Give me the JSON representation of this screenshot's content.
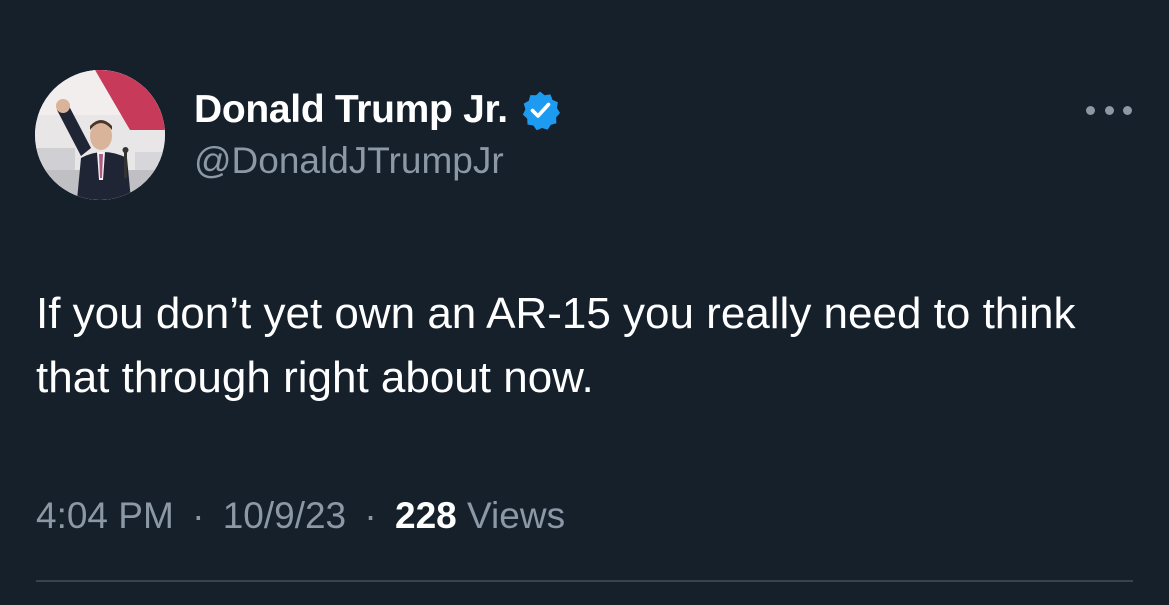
{
  "author": {
    "display_name": "Donald Trump Jr.",
    "handle": "@DonaldJTrumpJr",
    "verified": true
  },
  "tweet": {
    "text": "If you don’t yet own an AR-15 you really need to think that through right about now."
  },
  "meta": {
    "time": "4:04 PM",
    "separator": "·",
    "date": "10/9/23",
    "views_count": "228",
    "views_label": "Views"
  },
  "icons": {
    "verified": "verified-badge-icon",
    "more": "more-options-icon"
  },
  "colors": {
    "background": "#15202b",
    "text_primary": "#ffffff",
    "text_secondary": "#8b98a5",
    "verified_blue": "#1d9bf0",
    "divider": "#38444d"
  }
}
